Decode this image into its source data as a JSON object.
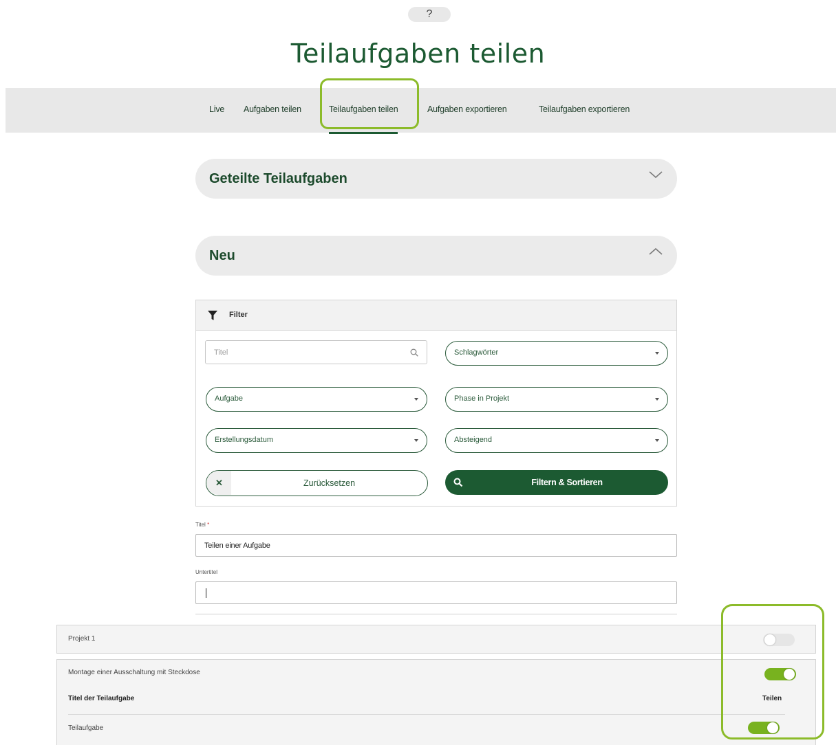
{
  "header": {
    "help_label": "?",
    "title": "Teilaufgaben teilen"
  },
  "nav": {
    "items": [
      {
        "label": "Live"
      },
      {
        "label": "Aufgaben teilen"
      },
      {
        "label": "Teilaufgaben teilen",
        "active": true
      },
      {
        "label": "Aufgaben exportieren"
      },
      {
        "label": "Teilaufgaben exportieren"
      }
    ]
  },
  "accordions": {
    "shared": {
      "title": "Geteilte Teilaufgaben",
      "expanded": false
    },
    "new": {
      "title": "Neu",
      "expanded": true
    }
  },
  "filter": {
    "heading": "Filter",
    "title_placeholder": "Titel",
    "tags_select": "Schlagwörter",
    "task_select": "Aufgabe",
    "phase_select": "Phase in Projekt",
    "date_select": "Erstellungsdatum",
    "order_select": "Absteigend",
    "reset_label": "Zurücksetzen",
    "apply_label": "Filtern & Sortieren"
  },
  "form": {
    "title_label": "Titel",
    "required_mark": "*",
    "title_value": "Teilen einer Aufgabe",
    "subtitle_label": "Untertitel",
    "subtitle_value": ""
  },
  "projects": {
    "project_label": "Projekt 1",
    "project_toggle_on": false,
    "task_label": "Montage einer Ausschaltung mit Steckdose",
    "task_toggle_on": true,
    "col_title": "Titel der Teilaufgabe",
    "col_share": "Teilen",
    "subtask_label": "Teilaufgabe",
    "subtask_toggle_on": true
  },
  "colors": {
    "brand_green": "#1c5a32",
    "toggle_on": "#78b21f",
    "highlight": "#8cbb2a"
  }
}
